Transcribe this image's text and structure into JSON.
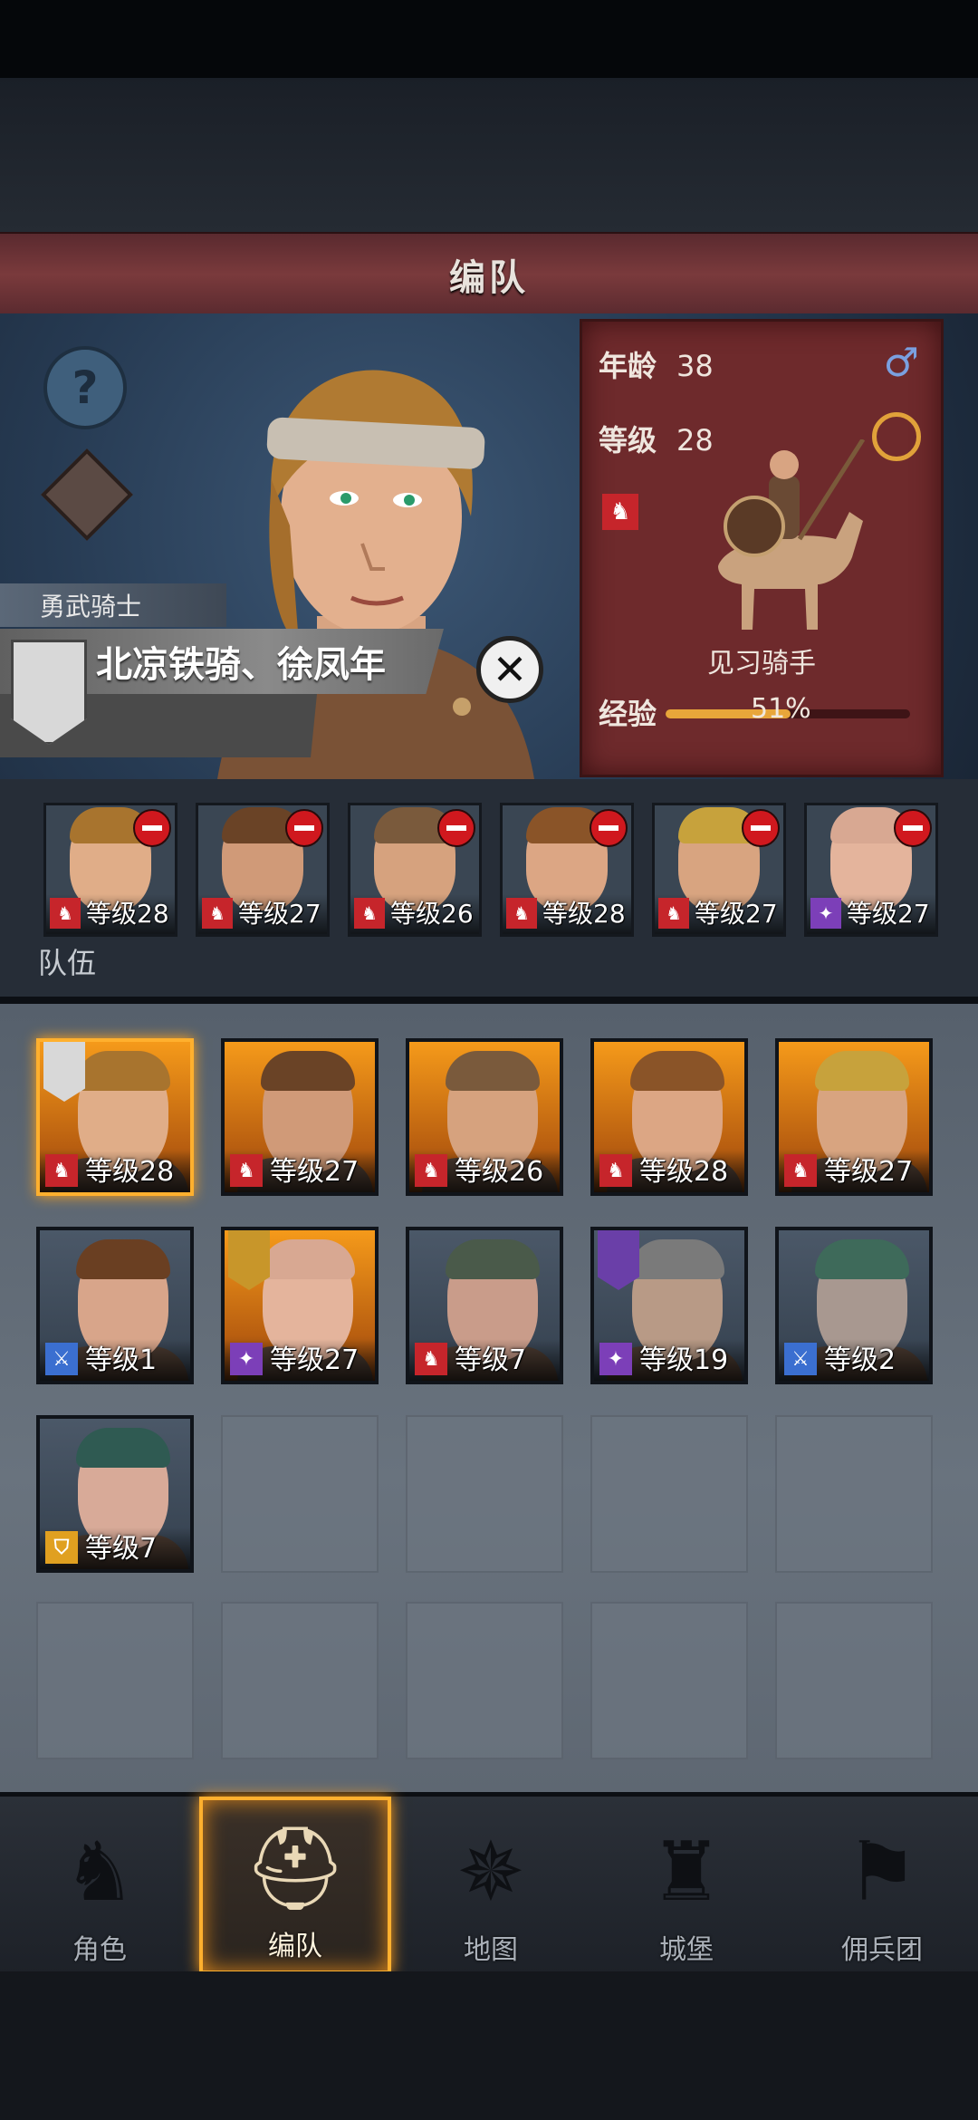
{
  "header": {
    "title": "编队"
  },
  "hero": {
    "class_label": "勇武骑士",
    "name": "北凉铁骑、徐凤年",
    "stats": {
      "age_label": "年龄",
      "age": "38",
      "level_label": "等级",
      "level": "28",
      "gender_icon": "male-icon"
    },
    "unit_name": "见习骑手",
    "exp_label": "经验",
    "exp_value": "51%",
    "exp_fraction": 0.51
  },
  "team": {
    "label": "队伍",
    "members": [
      {
        "level": "等级28",
        "type": "cavalry",
        "hair": "#a8742e",
        "skin": "#e0ad88"
      },
      {
        "level": "等级27",
        "type": "cavalry",
        "hair": "#6a4326",
        "skin": "#d09a78"
      },
      {
        "level": "等级26",
        "type": "cavalry",
        "hair": "#7a5a3c",
        "skin": "#d6a27e"
      },
      {
        "level": "等级28",
        "type": "cavalry",
        "hair": "#8a5428",
        "skin": "#dca684"
      },
      {
        "level": "等级27",
        "type": "cavalry",
        "hair": "#c7a23c",
        "skin": "#d8a480"
      },
      {
        "level": "等级27",
        "type": "mage",
        "hair": "#d8a892",
        "skin": "#e4b49c"
      }
    ]
  },
  "roster": [
    {
      "level": "等级28",
      "type": "cavalry",
      "bg": "orange",
      "selected": true,
      "tag": "white",
      "hair": "#a8742e",
      "skin": "#e0ad88"
    },
    {
      "level": "等级27",
      "type": "cavalry",
      "bg": "orange",
      "hair": "#6a4326",
      "skin": "#d09a78"
    },
    {
      "level": "等级26",
      "type": "cavalry",
      "bg": "orange",
      "hair": "#7a5a3c",
      "skin": "#d6a27e"
    },
    {
      "level": "等级28",
      "type": "cavalry",
      "bg": "orange",
      "hair": "#8a5428",
      "skin": "#dca684"
    },
    {
      "level": "等级27",
      "type": "cavalry",
      "bg": "orange",
      "hair": "#c7a23c",
      "skin": "#d8a480"
    },
    {
      "level": "等级1",
      "type": "sword",
      "bg": "gray",
      "hair": "#6a3f22",
      "skin": "#d8a58a"
    },
    {
      "level": "等级27",
      "type": "mage",
      "bg": "orange",
      "tag": "gold",
      "hair": "#d8a892",
      "skin": "#e4b49c"
    },
    {
      "level": "等级7",
      "type": "cavalry",
      "bg": "gray",
      "hair": "#4a5a4a",
      "skin": "#c99c8a"
    },
    {
      "level": "等级19",
      "type": "mage",
      "bg": "gray",
      "tag": "purple",
      "hair": "#7a7a7a",
      "skin": "#b89a86"
    },
    {
      "level": "等级2",
      "type": "sword",
      "bg": "gray",
      "hair": "#3e6a5a",
      "skin": "#a89890"
    },
    {
      "level": "等级7",
      "type": "shield",
      "bg": "gray",
      "hair": "#2f5a52",
      "skin": "#d8aa98"
    }
  ],
  "nav": [
    {
      "label": "角色",
      "icon": "knight-icon",
      "active": false
    },
    {
      "label": "编队",
      "icon": "helmet-icon",
      "active": true
    },
    {
      "label": "地图",
      "icon": "compass-icon",
      "active": false
    },
    {
      "label": "城堡",
      "icon": "castle-icon",
      "active": false
    },
    {
      "label": "佣兵团",
      "icon": "banner-icon",
      "active": false
    }
  ],
  "colors": {
    "accent": "#ffb02e",
    "banner_red": "#6e2a2c",
    "cavalry": "#c6252b",
    "mage": "#7c3fb8",
    "sword": "#3b6fd0",
    "shield": "#e0a020"
  }
}
